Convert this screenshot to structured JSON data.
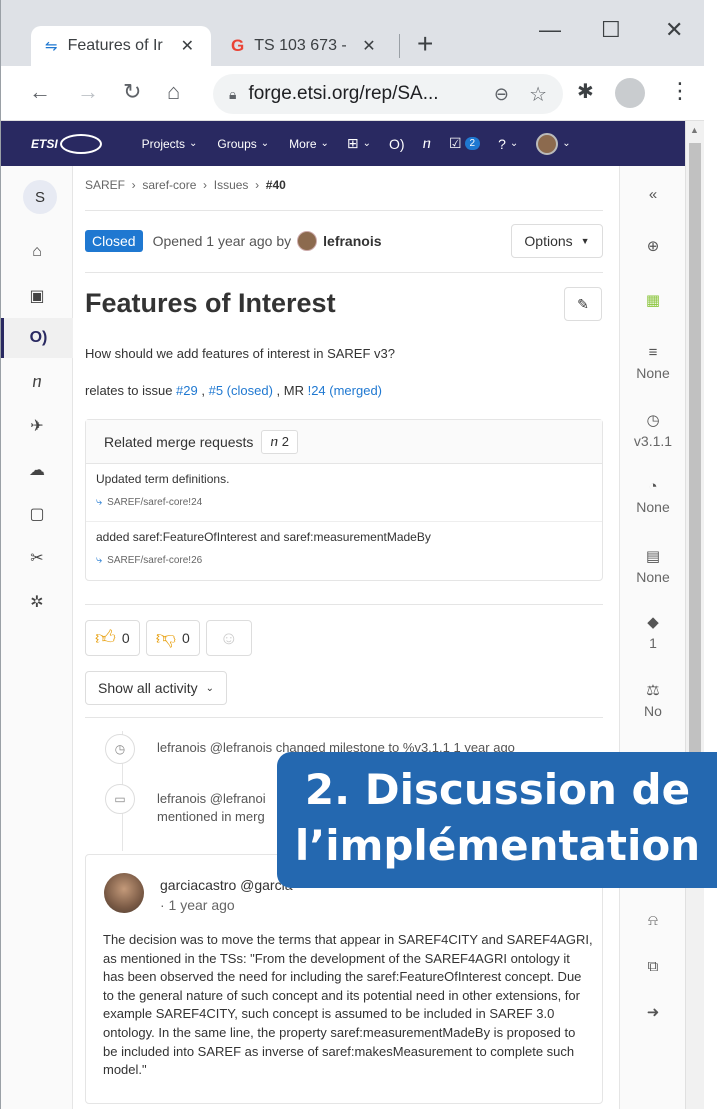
{
  "browser": {
    "tabs": [
      {
        "title": "Features of Ir",
        "active": true
      },
      {
        "title": "TS 103 673 -",
        "active": false
      }
    ],
    "url": "forge.etsi.org/rep/SA...",
    "controls": {
      "minimize": "—",
      "maximize": "☐",
      "close": "✕"
    }
  },
  "gitlab_nav": {
    "logo": "ETSI",
    "items": [
      "Projects",
      "Groups",
      "More"
    ],
    "todo_count": "2"
  },
  "sidebar_left": {
    "project_initial": "S"
  },
  "breadcrumb": [
    "SAREF",
    "saref-core",
    "Issues",
    "#40"
  ],
  "issue": {
    "status": "Closed",
    "opened_text": "Opened 1 year ago by",
    "author": "lefranois",
    "options_label": "Options",
    "title": "Features of Interest",
    "description": "How should we add features of interest in SAREF v3?",
    "relates_prefix": "relates to issue ",
    "relates_issue1": "#29",
    "relates_sep1": " , ",
    "relates_issue2": "#5 (closed)",
    "relates_sep2": " , MR ",
    "relates_mr": "!24 (merged)"
  },
  "related_mrs": {
    "header": "Related merge requests",
    "count": "2",
    "items": [
      {
        "title": "Updated term definitions.",
        "ref": "SAREF/saref-core!24"
      },
      {
        "title": "added saref:FeatureOfInterest and saref:measurementMadeBy",
        "ref": "SAREF/saref-core!26"
      }
    ]
  },
  "reactions": {
    "thumbs_up": "0",
    "thumbs_down": "0"
  },
  "activity_filter": "Show all activity",
  "system_notes": [
    {
      "text": "lefranois @lefranois changed milestone to %v3.1.1 1 year ago"
    },
    {
      "line1": "lefranois @lefranoi",
      "line2": "mentioned in merg"
    }
  ],
  "comment": {
    "author": "garciacastro @garcia",
    "time": "· 1 year ago",
    "body": "The decision was to move the terms that appear in SAREF4CITY and SAREF4AGRI, as mentioned in the TSs: \"From the development of the SAREF4AGRI ontology it has been observed the need for including the saref:FeatureOfInterest concept. Due to the general nature of such concept and its potential need in other extensions, for example SAREF4CITY, such concept is assumed to be included in SAREF 3.0 ontology. In the same line, the property saref:measurementMadeBy is proposed to be included into SAREF as inverse of saref:makesMeasurement to complete such model.\""
  },
  "sidebar_right": {
    "collapse": "«",
    "items": [
      {
        "icon": "todo-icon",
        "glyph": "⊕",
        "value": ""
      },
      {
        "icon": "assignee-icon",
        "glyph": "▦",
        "value": ""
      },
      {
        "icon": "epic-icon",
        "glyph": "≡",
        "value": "None"
      },
      {
        "icon": "milestone-icon",
        "glyph": "◷",
        "value": "v3.1.1"
      },
      {
        "icon": "time-icon",
        "glyph": "◔",
        "value": "None"
      },
      {
        "icon": "due-date-icon",
        "glyph": "▤",
        "value": "None"
      },
      {
        "icon": "labels-icon",
        "glyph": "◆",
        "value": "1"
      },
      {
        "icon": "weight-icon",
        "glyph": "⚖",
        "value": "No"
      }
    ],
    "bottom_icons": [
      "notification-icon",
      "copy-icon",
      "move-icon"
    ]
  },
  "overlay": {
    "line1": "2. Discussion de",
    "line2": "l’implémentation"
  },
  "colors": {
    "gitlab_header": "#292961",
    "link": "#1f78d1",
    "closed_badge": "#1f78d1",
    "overlay": "#2468b0"
  }
}
